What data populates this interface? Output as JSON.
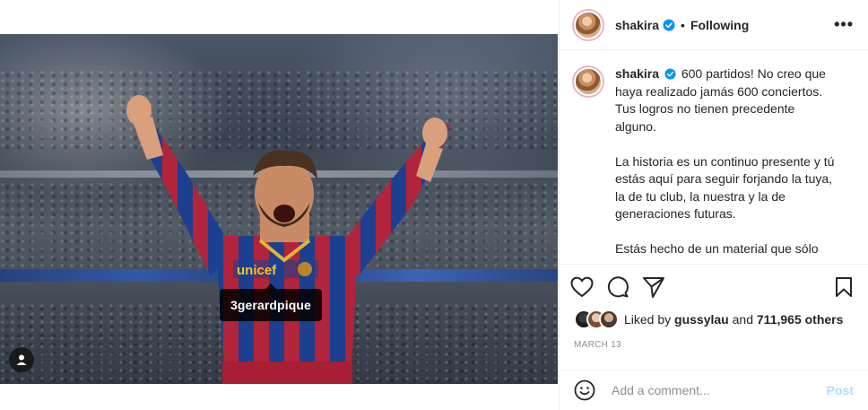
{
  "header": {
    "username": "shakira",
    "separator": "•",
    "follow_state": "Following",
    "more_label": "•••"
  },
  "media": {
    "tag_label": "3gerardpique",
    "jersey_text": "unicef",
    "colors": {
      "jersey_blue": "#1d3f8f",
      "jersey_red": "#b2243b",
      "shorts": "#a71f33"
    }
  },
  "caption": {
    "username": "shakira",
    "paragraphs": [
      "600 partidos! No creo que haya realizado jamás 600 conciertos. Tus logros no tienen precedente alguno.",
      "La historia es un continuo presente y tú estás aquí para seguir forjando la tuya, la de tu club, la nuestra y la de generaciones futuras.",
      "Estás hecho de un material que sólo"
    ]
  },
  "actions": {
    "icons": [
      "heart-icon",
      "comment-icon",
      "share-icon",
      "bookmark-icon"
    ]
  },
  "likes": {
    "prefix": "Liked by",
    "liked_by_user": "gussylau",
    "conjunction": "and",
    "others": "711,965 others"
  },
  "date": "MARCH 13",
  "comment": {
    "placeholder": "Add a comment...",
    "post_label": "Post",
    "post_color": "#b3dbff"
  },
  "colors": {
    "verified": "#0095f6",
    "text": "#262626",
    "muted": "#8e8e8e",
    "divider": "#efefef"
  }
}
